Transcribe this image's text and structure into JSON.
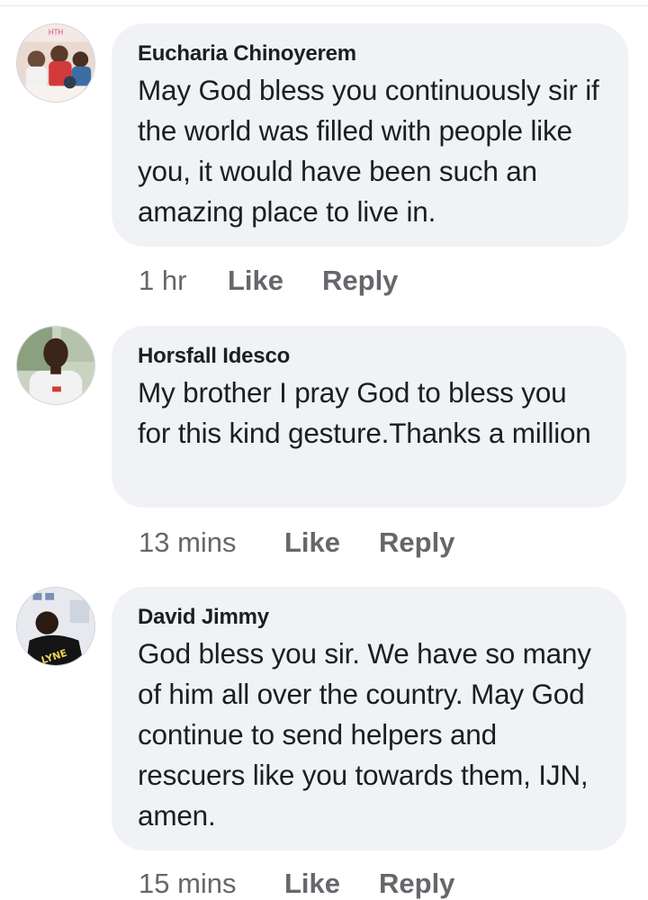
{
  "comments": [
    {
      "author": "Eucharia Chinoyerem",
      "text": "May God bless you continuously sir if the world was filled with people like you, it would have been such an amazing place to live in.",
      "time": "1 hr",
      "like_label": "Like",
      "reply_label": "Reply",
      "avatar": "group-photo-avatar"
    },
    {
      "author": "Horsfall Idesco",
      "text": "My brother I pray God to bless you for this kind gesture.Thanks a million",
      "time": "13 mins",
      "like_label": "Like",
      "reply_label": "Reply",
      "avatar": "man-in-white-shirt-avatar"
    },
    {
      "author": "David Jimmy",
      "text": "God bless you sir. We have so many of him all over the country. May God continue to send helpers and rescuers like you towards them, IJN, amen.",
      "time": "15 mins",
      "like_label": "Like",
      "reply_label": "Reply",
      "avatar": "man-in-jersey-avatar"
    }
  ],
  "colors": {
    "bubble": "#f0f2f5",
    "text": "#1c1e21",
    "meta": "#65676b"
  }
}
